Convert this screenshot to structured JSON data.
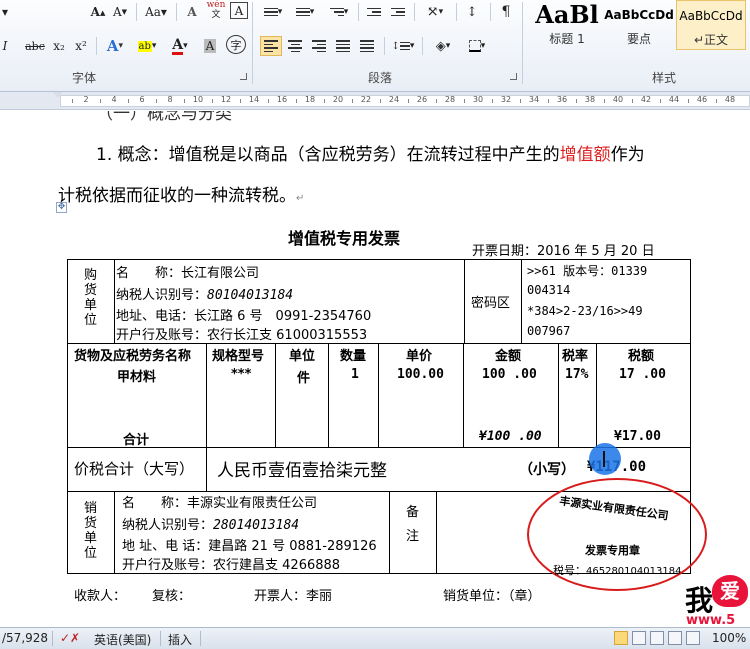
{
  "ribbon": {
    "font_group_label": "字体",
    "paragraph_group_label": "段落",
    "styles_group_label": "样式",
    "row1_font": [
      "A",
      "A",
      "Aa",
      "A",
      "wén",
      "A"
    ],
    "row2_font": [
      "abc",
      "x₂",
      "x²",
      "A",
      "ab",
      "A",
      "A",
      "字"
    ],
    "styles": [
      {
        "sample": "AaBl",
        "name": "标题 1"
      },
      {
        "sample": "AaBbCcDd",
        "name": "要点"
      },
      {
        "sample": "AaBbCcDd",
        "name": "↵正文"
      }
    ]
  },
  "ruler": {
    "numbers": [
      "2",
      "4",
      "6",
      "8",
      "10",
      "12",
      "14",
      "16",
      "18",
      "20",
      "22",
      "24",
      "26",
      "28",
      "30",
      "32",
      "34",
      "36",
      "38",
      "40",
      "42",
      "44",
      "46",
      "48"
    ]
  },
  "doc": {
    "para_top_partial": "（一）概念与分类",
    "para1_a": "1. 概念：增值税是以商品（含应税劳务）在流转过程中产生的",
    "para1_red": "增值额",
    "para1_b": "作为",
    "para2": "计税依据而征收的一种流转税。",
    "pm": "↵"
  },
  "invoice": {
    "title": "增值税专用发票",
    "date_label": "开票日期：",
    "date_value": "2016 年 5 月 20 日",
    "buyer_label": "购货单位",
    "buyer_name_label": "名　　称：",
    "buyer_name": "长江有限公司",
    "buyer_taxid_label": "纳税人识别号：",
    "buyer_taxid": "80104013184",
    "buyer_addr_label": "地址、电话：",
    "buyer_addr": "长江路 6 号　0991-2354760",
    "buyer_bank_label": "开户行及账号：",
    "buyer_bank": "农行长江支 61000315553",
    "cipher_label": "密码区",
    "cipher_lines": [
      ">>61 版本号：01339",
      "004314",
      "*384>2-23/16>>49",
      "007967"
    ],
    "headers": [
      "货物及应税劳务名称",
      "规格型号",
      "单位",
      "数量",
      "单价",
      "金额",
      "税率",
      "税额"
    ],
    "item": [
      "甲材料",
      "***",
      "件",
      "1",
      "100.00",
      "100 .00",
      "17%",
      "17 .00"
    ],
    "total_label": "合计",
    "total_amount": "¥100 .00",
    "total_tax": "¥17.00",
    "grand_label": "价税合计（大写）",
    "grand_upper": "人民币壹佰壹拾柒元整",
    "grand_small_label": "（小写）",
    "grand_small": "¥117.00",
    "seller_label": "销货单位",
    "seller_name_label": "名　　称：",
    "seller_name": "丰源实业有限责任公司",
    "seller_taxid_label": "纳税人识别号：",
    "seller_taxid": "28014013184",
    "seller_addr_label": "地 址、电 话：",
    "seller_addr": "建昌路 21 号 0881-289126",
    "seller_bank_label": "开户行及账号：",
    "seller_bank": "农行建昌支 4266888",
    "remark_label": "备注",
    "footer_payee": "收款人：",
    "footer_review": "复核：",
    "footer_issuer": "开票人：李丽",
    "footer_seller": "销货单位：（章）"
  },
  "stamp": {
    "company": "丰源实业有限责任公司",
    "seal_type": "发票专用章",
    "tax_label": "税号：",
    "tax_no": "465280104013184",
    "color": "#d81c1c"
  },
  "watermark": {
    "big": "我",
    "heart": "爱",
    "url": "www.5"
  },
  "status": {
    "words": "/57,928",
    "language": "英语(美国)",
    "mode": "插入",
    "zoom": "100%"
  }
}
